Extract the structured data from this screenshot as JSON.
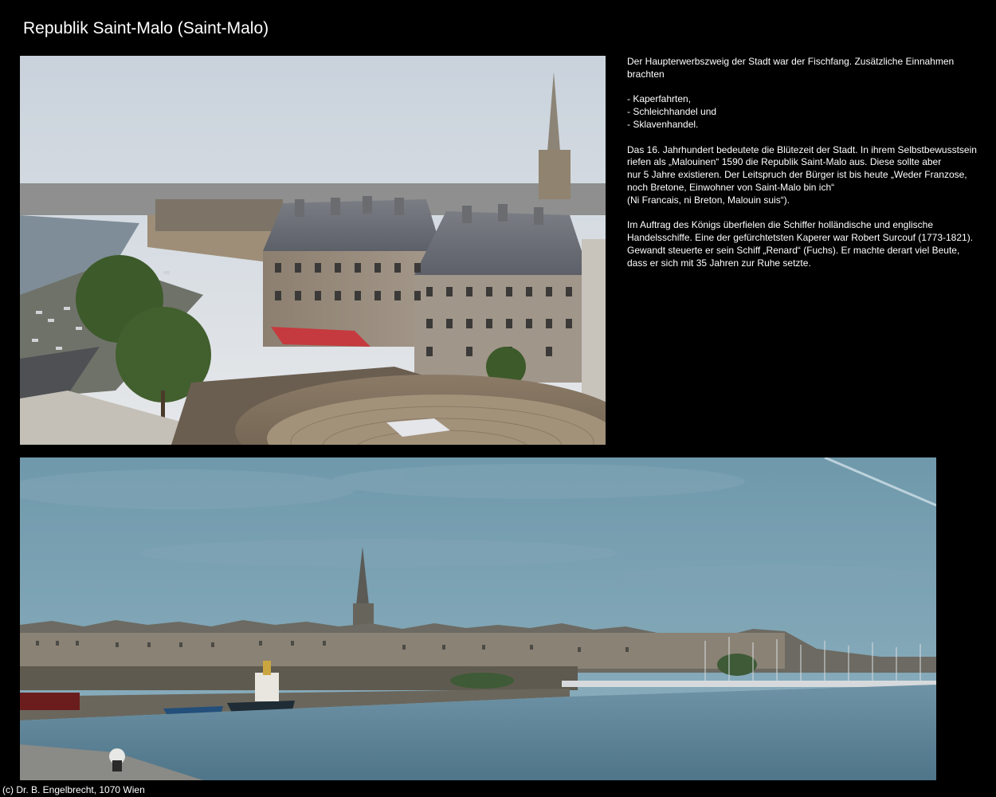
{
  "page": {
    "title": "Republik Saint-Malo (Saint-Malo)",
    "footer": "(c) Dr. B. Engelbrecht, 1070 Wien"
  },
  "text": {
    "p1": [
      "Der Haupterwerbszweig der Stadt war der Fischfang. Zusätzliche Einnahmen",
      "brachten"
    ],
    "list": [
      "- Kaperfahrten,",
      "- Schleichhandel und",
      "- Sklavenhandel."
    ],
    "p2": [
      "Das 16. Jahrhundert bedeutete die Blütezeit der Stadt. In ihrem Selbstbewusstsein",
      "riefen als „Malouinen“ 1590 die Republik Saint-Malo aus. Diese sollte aber",
      "nur 5 Jahre existieren. Der Leitspruch der Bürger ist bis heute „Weder Franzose,",
      "noch Bretone, Einwohner von Saint-Malo bin ich“",
      "(Ni Francais, ni Breton, Malouin suis“)."
    ],
    "p3": [
      "Im Auftrag des Königs überfielen die Schiffer holländische und englische",
      "Handelsschiffe. Eine der gefürchtetsten Kaperer war Robert Surcouf (1773-1821).",
      "Gewandt steuerte er sein Schiff „Renard“ (Fuchs). Er machte derart viel Beute,",
      "dass er sich mit 35 Jahren zur Ruhe setzte."
    ]
  },
  "photos": [
    {
      "subject": "rooftop view over walled old town, harbour and cathedral spire"
    },
    {
      "subject": "panorama of walled old town across the harbour water"
    }
  ],
  "colors": {
    "background": "#000000",
    "text": "#ffffff"
  }
}
